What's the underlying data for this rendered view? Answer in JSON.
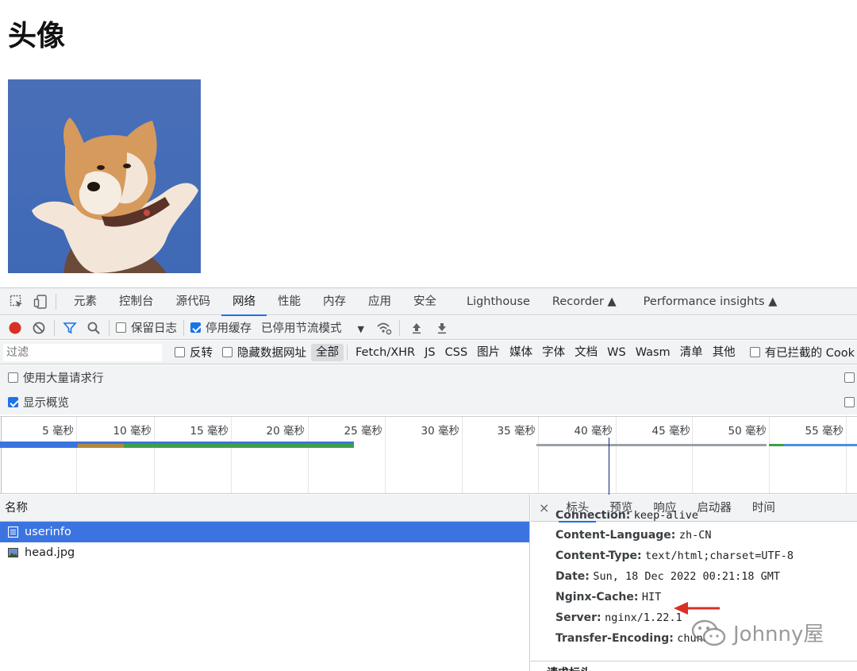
{
  "page": {
    "title": "头像"
  },
  "devtools": {
    "tabs": [
      "元素",
      "控制台",
      "源代码",
      "网络",
      "性能",
      "内存",
      "应用",
      "安全",
      "Lighthouse",
      "Recorder",
      "Performance insights"
    ],
    "active_tab": "网络",
    "toolbar": {
      "preserve_log": "保留日志",
      "disable_cache": "停用缓存",
      "throttling": "已停用节流模式"
    },
    "filter": {
      "placeholder": "过滤",
      "invert": "反转",
      "hide_data_urls": "隐藏数据网址",
      "types": [
        "全部",
        "Fetch/XHR",
        "JS",
        "CSS",
        "图片",
        "媒体",
        "字体",
        "文档",
        "WS",
        "Wasm",
        "清单",
        "其他"
      ],
      "blocked_cookies": "有已拦截的 Cook"
    },
    "options": {
      "big_rows": "使用大量请求行",
      "show_overview": "显示概览"
    },
    "overview_ticks": [
      "5 毫秒",
      "10 毫秒",
      "15 毫秒",
      "20 毫秒",
      "25 毫秒",
      "30 毫秒",
      "35 毫秒",
      "40 毫秒",
      "45 毫秒",
      "50 毫秒",
      "55 毫秒"
    ],
    "requests": {
      "column": "名称",
      "items": [
        "userinfo",
        "head.jpg"
      ]
    },
    "detail": {
      "tabs": [
        "标头",
        "预览",
        "响应",
        "启动器",
        "时间"
      ],
      "active": "标头",
      "headers": [
        {
          "k": "Connection:",
          "v": "keep-alive"
        },
        {
          "k": "Content-Language:",
          "v": "zh-CN"
        },
        {
          "k": "Content-Type:",
          "v": "text/html;charset=UTF-8"
        },
        {
          "k": "Date:",
          "v": "Sun, 18 Dec 2022 00:21:18 GMT"
        },
        {
          "k": "Nginx-Cache:",
          "v": "HIT"
        },
        {
          "k": "Server:",
          "v": "nginx/1.22.1"
        },
        {
          "k": "Transfer-Encoding:",
          "v": "chunked"
        }
      ],
      "next_section": "请求标头"
    }
  },
  "watermark": "Johnny屋",
  "colors": {
    "accent": "#1a73e8",
    "selected_row": "#3b74e0",
    "arrow": "#d93025"
  }
}
